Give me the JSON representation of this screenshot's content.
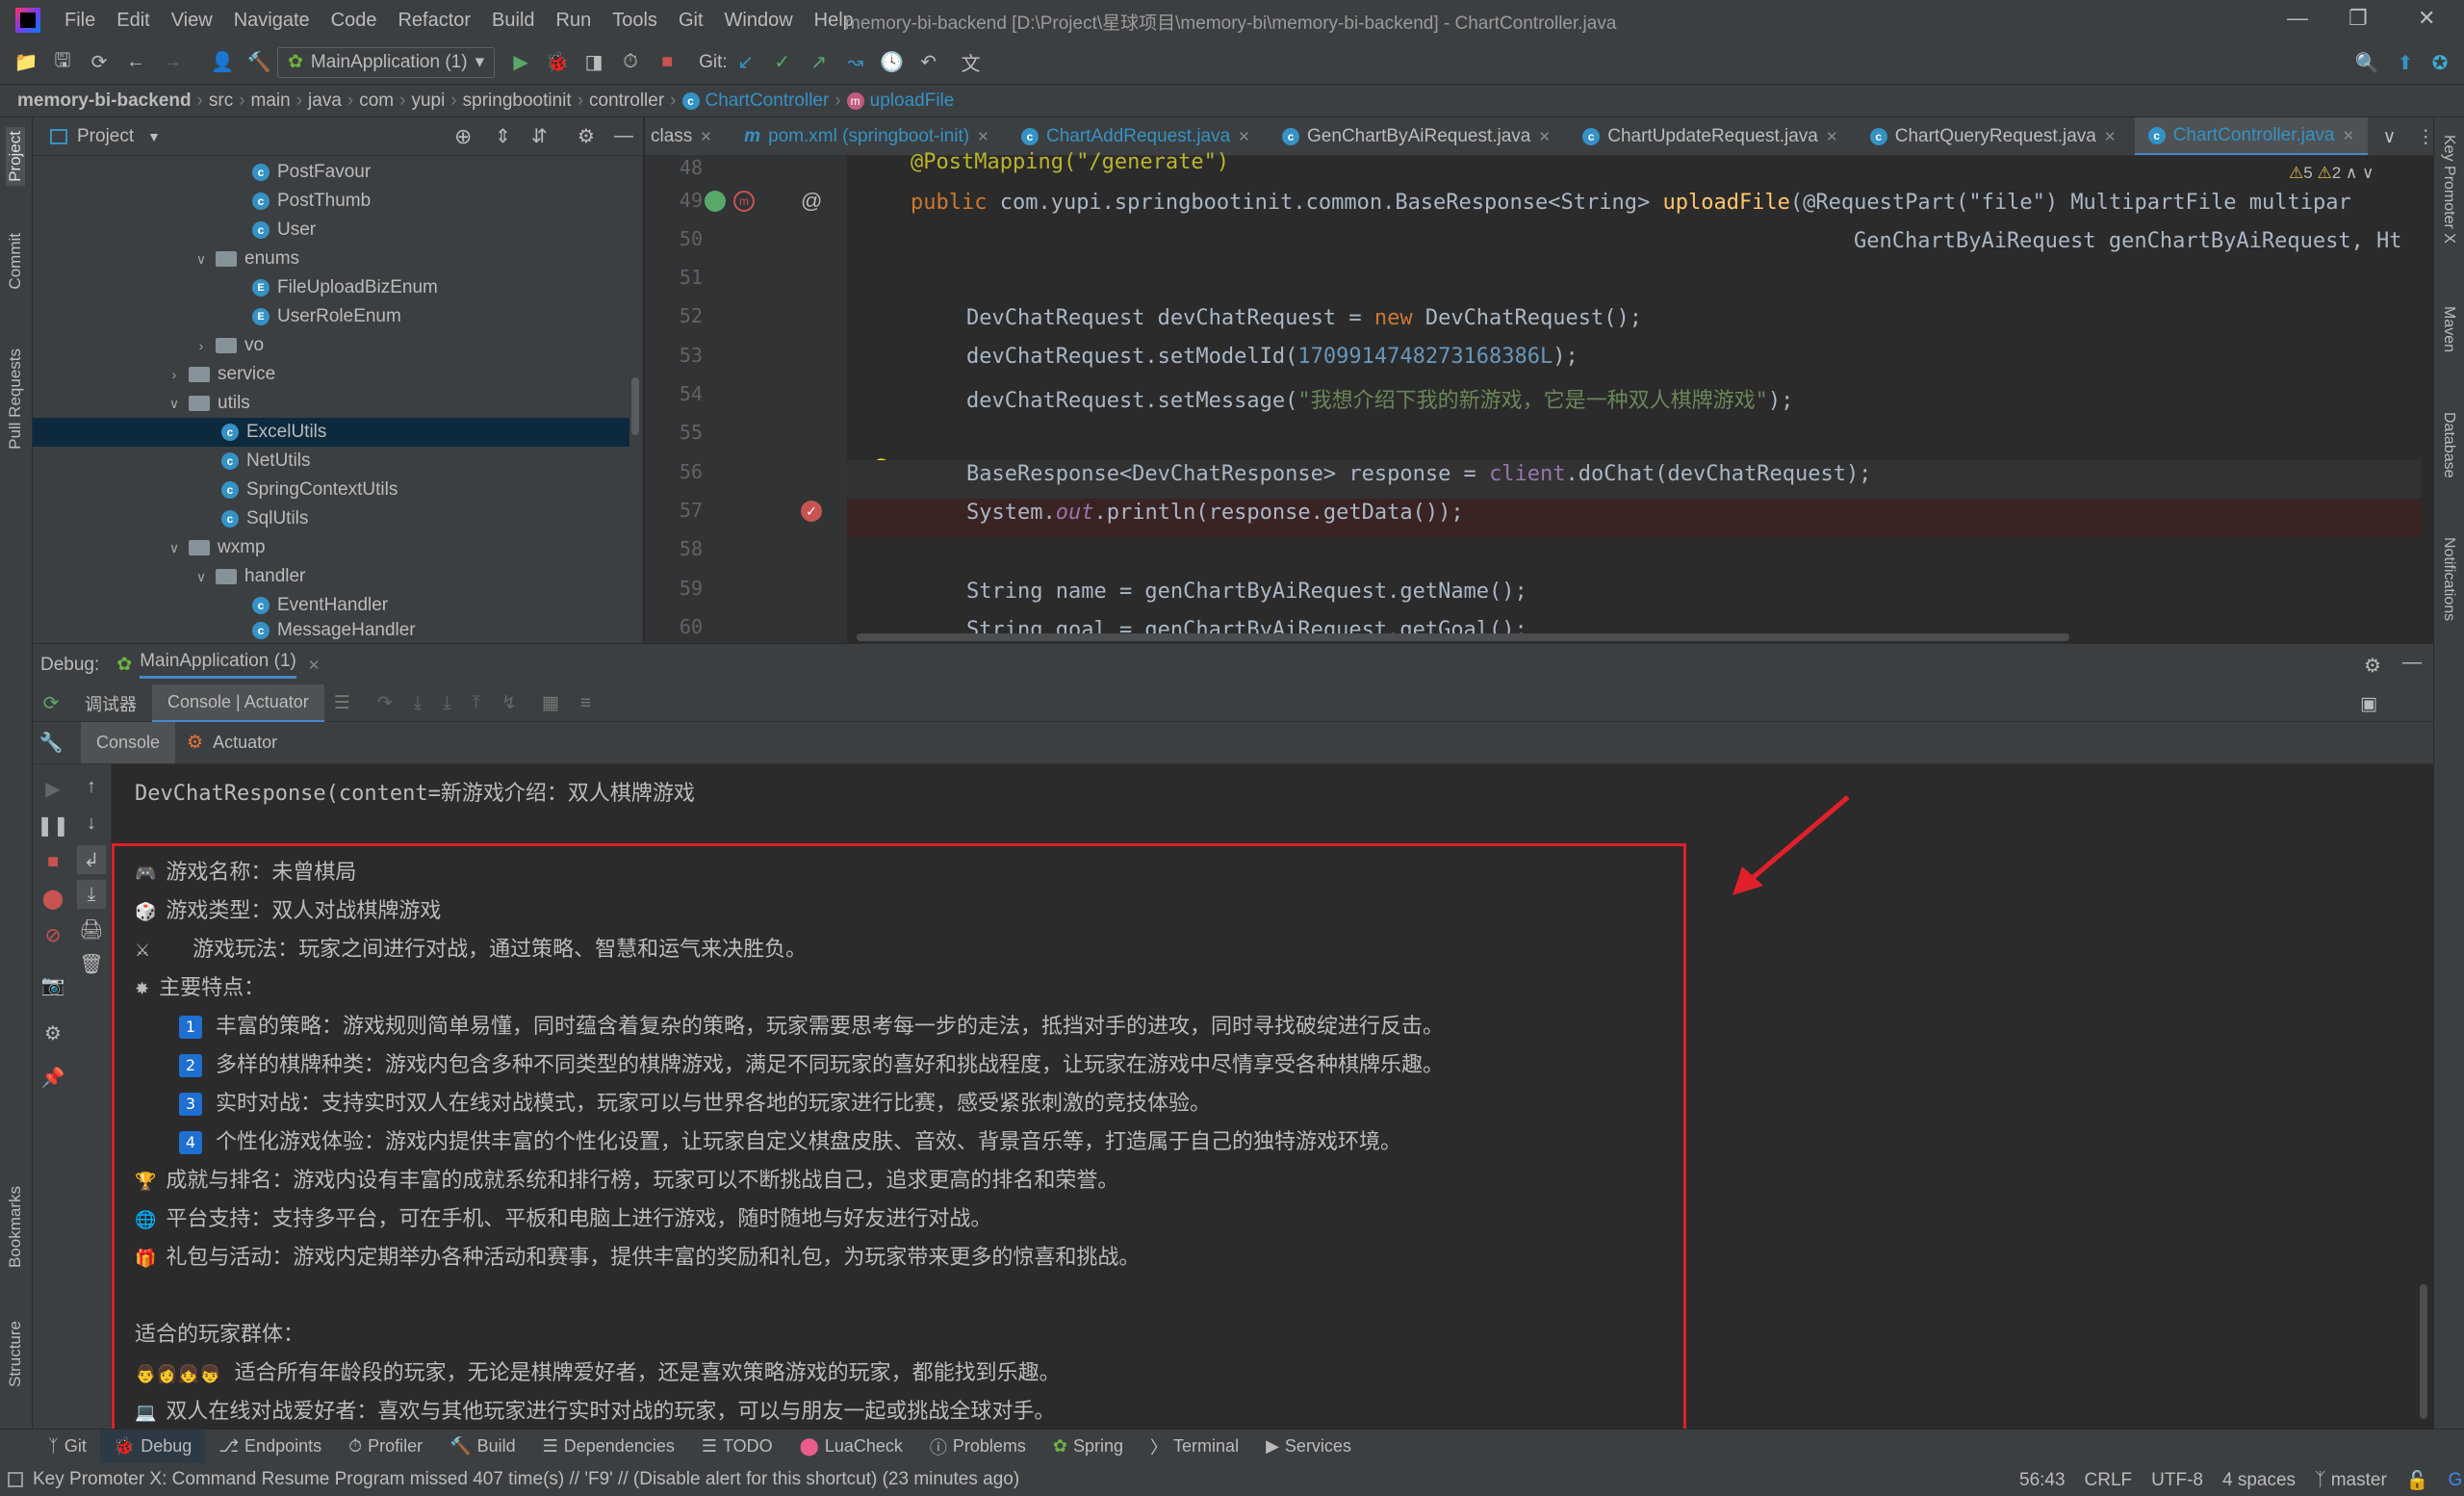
{
  "titlebar": {
    "menu": [
      "File",
      "Edit",
      "View",
      "Navigate",
      "Code",
      "Refactor",
      "Build",
      "Run",
      "Tools",
      "Git",
      "Window",
      "Help"
    ],
    "title": "memory-bi-backend [D:\\Project\\星球项目\\memory-bi\\memory-bi-backend] - ChartController.java"
  },
  "toolbar": {
    "run_config": "MainApplication (1)",
    "git_label": "Git:"
  },
  "breadcrumb": [
    "memory-bi-backend",
    "src",
    "main",
    "java",
    "com",
    "yupi",
    "springbootinit",
    "controller",
    "ChartController",
    "uploadFile"
  ],
  "project": {
    "title": "Project",
    "items": [
      {
        "label": "PostFavour",
        "type": "class"
      },
      {
        "label": "PostThumb",
        "type": "class"
      },
      {
        "label": "User",
        "type": "class"
      },
      {
        "label": "enums",
        "type": "folder"
      },
      {
        "label": "FileUploadBizEnum",
        "type": "enum"
      },
      {
        "label": "UserRoleEnum",
        "type": "enum"
      },
      {
        "label": "vo",
        "type": "folder"
      },
      {
        "label": "service",
        "type": "folder"
      },
      {
        "label": "utils",
        "type": "folder"
      },
      {
        "label": "ExcelUtils",
        "type": "class"
      },
      {
        "label": "NetUtils",
        "type": "class"
      },
      {
        "label": "SpringContextUtils",
        "type": "class"
      },
      {
        "label": "SqlUtils",
        "type": "class"
      },
      {
        "label": "wxmp",
        "type": "folder"
      },
      {
        "label": "handler",
        "type": "folder"
      },
      {
        "label": "EventHandler",
        "type": "class"
      },
      {
        "label": "MessageHandler",
        "type": "class"
      }
    ]
  },
  "editor": {
    "tabs": [
      "class",
      "pom.xml (springboot-init)",
      "ChartAddRequest.java",
      "GenChartByAiRequest.java",
      "ChartUpdateRequest.java",
      "ChartQueryRequest.java",
      "ChartController.java"
    ],
    "warnings": "5",
    "weak_warnings": "2",
    "line_numbers": [
      "48",
      "49",
      "50",
      "51",
      "52",
      "53",
      "54",
      "55",
      "56",
      "57",
      "58",
      "59",
      "60"
    ],
    "code": {
      "l48": "@PostMapping(\"/generate\")",
      "l49a": "public ",
      "l49b": "com.yupi.springbootinit.common.BaseResponse<String> ",
      "l49c": "uploadFile",
      "l49d": "(@RequestPart(\"file\") MultipartFile multipar",
      "l50": "GenChartByAiRequest genChartByAiRequest, Ht",
      "l52a": "DevChatRequest devChatRequest = ",
      "l52b": "new ",
      "l52c": "DevChatRequest();",
      "l53a": "devChatRequest.setModelId(",
      "l53b": "1709914748273168386L",
      "l53c": ");",
      "l54a": "devChatRequest.setMessage(",
      "l54b": "\"我想介绍下我的新游戏，它是一种双人棋牌游戏\"",
      "l54c": ");",
      "l56a": "BaseResponse<DevChatResponse> response = ",
      "l56b": "client",
      "l56c": ".doChat(devChatRequest);",
      "l57a": "System.",
      "l57b": "out",
      "l57c": ".println(response.getData());",
      "l59": "String name = genChartByAiRequest.getName();",
      "l60": "String goal = genChartByAiRequest.getGoal();"
    }
  },
  "debug": {
    "label": "Debug:",
    "session": "MainApplication (1)",
    "tabs": [
      "调试器",
      "Console | Actuator"
    ],
    "subtabs": [
      "Console",
      "Actuator"
    ]
  },
  "console": {
    "first": "DevChatResponse(content=新游戏介绍：双人棋牌游戏",
    "lines": [
      {
        "icon": "🎮",
        "text": "游戏名称：未曾棋局"
      },
      {
        "icon": "🎲",
        "text": "游戏类型：双人对战棋牌游戏"
      },
      {
        "icon": "⚔",
        "text": "游戏玩法：玩家之间进行对战，通过策略、智慧和运气来决胜负。"
      },
      {
        "icon": "🌟",
        "text": "主要特点："
      }
    ],
    "features": [
      {
        "n": "1",
        "text": "丰富的策略：游戏规则简单易懂，同时蕴含着复杂的策略，玩家需要思考每一步的走法，抵挡对手的进攻，同时寻找破绽进行反击。"
      },
      {
        "n": "2",
        "text": "多样的棋牌种类：游戏内包含多种不同类型的棋牌游戏，满足不同玩家的喜好和挑战程度，让玩家在游戏中尽情享受各种棋牌乐趣。"
      },
      {
        "n": "3",
        "text": "实时对战：支持实时双人在线对战模式，玩家可以与世界各地的玩家进行比赛，感受紧张刺激的竞技体验。"
      },
      {
        "n": "4",
        "text": "个性化游戏体验：游戏内提供丰富的个性化设置，让玩家自定义棋盘皮肤、音效、背景音乐等，打造属于自己的独特游戏环境。"
      }
    ],
    "more": [
      {
        "icon": "🏆",
        "text": "成就与排名：游戏内设有丰富的成就系统和排行榜，玩家可以不断挑战自己，追求更高的排名和荣誉。"
      },
      {
        "icon": "🌐",
        "text": "平台支持：支持多平台，可在手机、平板和电脑上进行游戏，随时随地与好友进行对战。"
      },
      {
        "icon": "🎁",
        "text": "礼包与活动：游戏内定期举办各种活动和赛事，提供丰富的奖励和礼包，为玩家带来更多的惊喜和挑战。"
      }
    ],
    "audience_title": "适合的玩家群体：",
    "audience": [
      {
        "icon": "👨👩👧👦",
        "text": "适合所有年龄段的玩家，无论是棋牌爱好者，还是喜欢策略游戏的玩家，都能找到乐趣。"
      },
      {
        "icon": "💻",
        "text": "双人在线对战爱好者：喜欢与其他玩家进行实时对战的玩家，可以与朋友一起或挑战全球对手。"
      }
    ]
  },
  "bottom_tabs": [
    "Git",
    "Debug",
    "Endpoints",
    "Profiler",
    "Build",
    "Dependencies",
    "TODO",
    "LuaCheck",
    "Problems",
    "Spring",
    "Terminal",
    "Services"
  ],
  "left_tools": [
    "Project",
    "Commit",
    "Pull Requests",
    "Bookmarks",
    "Structure"
  ],
  "right_tools": [
    "Key Promoter X",
    "Maven",
    "Database",
    "Notifications"
  ],
  "status": {
    "message": "Key Promoter X: Command Resume Program missed 407 time(s) // 'F9' // (Disable alert for this shortcut) (23 minutes ago)",
    "position": "56:43",
    "line_sep": "CRLF",
    "encoding": "UTF-8",
    "indent": "4 spaces",
    "branch": "master"
  },
  "colors": {
    "accent": "#4a88c7",
    "highlight_box": "#e0202a",
    "selection": "#0d293e"
  }
}
